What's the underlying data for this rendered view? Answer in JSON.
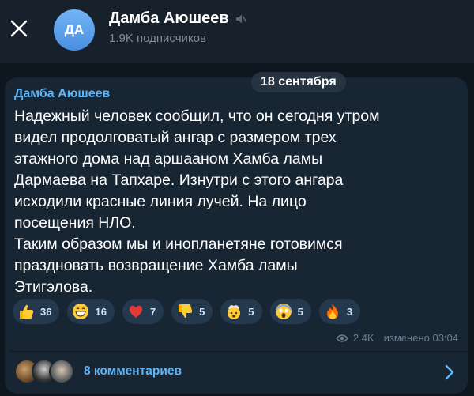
{
  "header": {
    "channel_name": "Дамба Аюшеев",
    "avatar_initials": "ДА",
    "subscribers": "1.9K подписчиков"
  },
  "date_pill": "18 сентября",
  "message": {
    "author": "Дамба Аюшеев",
    "text": "Надежный человек сообщил, что он сегодня утром\nвидел продолговатый ангар с размером трех\nэтажного дома над аршааном Хамба ламы\nДармаева на Тапхаре. Изнутри с этого ангара\nисходили красные линия лучей. На лицо\nпосещения НЛО.\nТаким образом мы и инопланетяне готовимся\nпраздновать возвращение Хамба ламы\nЭтигэлова.",
    "reactions": [
      {
        "icon": "thumbs-up-icon",
        "count": "36"
      },
      {
        "icon": "grinning-face-icon",
        "count": "16"
      },
      {
        "icon": "red-heart-icon",
        "count": "7"
      },
      {
        "icon": "thumbs-down-icon",
        "count": "5"
      },
      {
        "icon": "exploding-head-icon",
        "count": "5"
      },
      {
        "icon": "screaming-face-icon",
        "count": "5"
      },
      {
        "icon": "fire-icon",
        "count": "3"
      }
    ],
    "views": "2.4K",
    "edited": "изменено 03:04"
  },
  "comments": {
    "label": "8 комментариев"
  },
  "colors": {
    "accent": "#5eb5f7",
    "bubble": "#182533",
    "background": "#0e1620",
    "header": "#17212b"
  }
}
